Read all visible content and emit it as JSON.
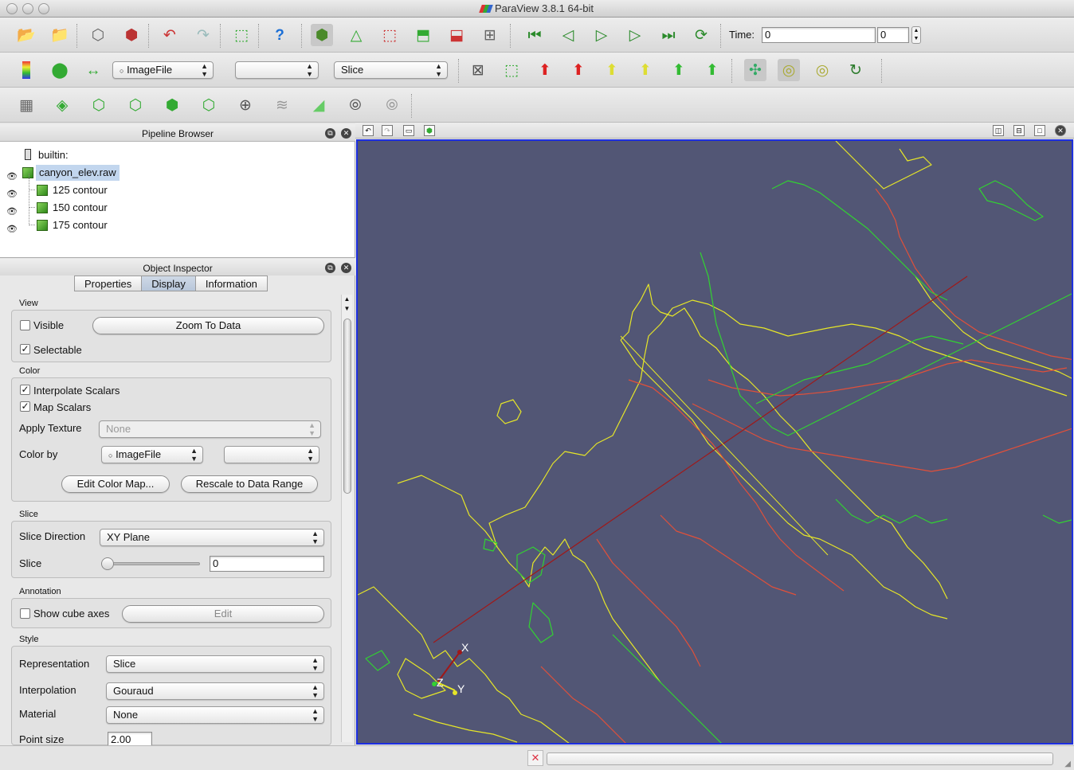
{
  "window": {
    "title": "ParaView 3.8.1 64-bit"
  },
  "toolbar_main": {
    "time_label": "Time:",
    "time_value": "0",
    "time_step": "0"
  },
  "toolbar_color": {
    "array_combo": "ImageFile",
    "component_combo": "",
    "representation_combo": "Slice"
  },
  "pipeline_browser": {
    "title": "Pipeline Browser",
    "items": [
      {
        "label": "builtin:"
      },
      {
        "label": "canyon_elev.raw"
      },
      {
        "label": "125 contour"
      },
      {
        "label": "150 contour"
      },
      {
        "label": "175 contour"
      }
    ]
  },
  "object_inspector": {
    "title": "Object Inspector",
    "tabs": [
      "Properties",
      "Display",
      "Information"
    ],
    "active_tab": "Display",
    "view": {
      "title": "View",
      "visible_label": "Visible",
      "zoom_button": "Zoom To Data",
      "selectable_label": "Selectable"
    },
    "color": {
      "title": "Color",
      "interpolate_label": "Interpolate Scalars",
      "map_scalars_label": "Map Scalars",
      "apply_texture_label": "Apply Texture",
      "apply_texture_value": "None",
      "color_by_label": "Color by",
      "color_by_value": "ImageFile",
      "color_by_component": "",
      "edit_color_map": "Edit Color Map...",
      "rescale": "Rescale to Data Range"
    },
    "slice": {
      "title": "Slice",
      "direction_label": "Slice Direction",
      "direction_value": "XY Plane",
      "slice_label": "Slice",
      "slice_value": "0"
    },
    "annotation": {
      "title": "Annotation",
      "cube_axes_label": "Show cube axes",
      "edit_button": "Edit"
    },
    "style": {
      "title": "Style",
      "representation_label": "Representation",
      "representation_value": "Slice",
      "interpolation_label": "Interpolation",
      "interpolation_value": "Gouraud",
      "material_label": "Material",
      "material_value": "None",
      "point_size_label": "Point size",
      "point_size_value": "2.00"
    }
  },
  "view": {
    "background": "#525675",
    "border": "#1c2ee0",
    "axes": {
      "x": "X",
      "y": "Y",
      "z": "Z"
    }
  },
  "colors": {
    "contour_125": "#e6e628",
    "contour_150": "#e0503a",
    "contour_175": "#32d232",
    "line_widget": "#a01818"
  }
}
